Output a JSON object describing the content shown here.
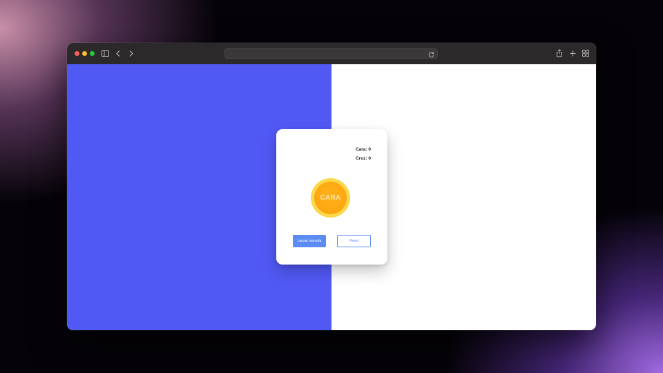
{
  "browser": {
    "icons": {
      "sidebar": "sidebar-icon",
      "back": "chevron-left-icon",
      "forward": "chevron-right-icon",
      "reload": "reload-icon",
      "share": "share-icon",
      "new_tab": "plus-icon",
      "tab_overview": "grid-icon"
    },
    "address_value": ""
  },
  "page": {
    "colors": {
      "left_background": "#5159f5",
      "right_background": "#ffffff",
      "button_accent": "#5b8cf3",
      "coin_rim": "#fbd84a",
      "coin_face": "#fda812"
    },
    "scores": {
      "cara": "Cara: 0",
      "cruz": "Cruz: 0"
    },
    "coin": {
      "label": "CARA"
    },
    "buttons": {
      "flip": "Lanzar moneda",
      "reset": "Reset"
    }
  }
}
